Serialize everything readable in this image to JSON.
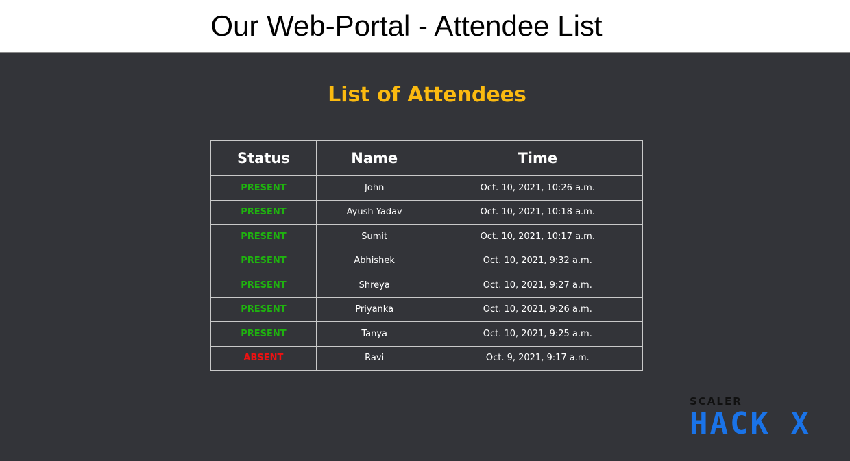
{
  "slide": {
    "title": "Our Web-Portal - Attendee List"
  },
  "page": {
    "heading": "List of Attendees"
  },
  "table": {
    "headers": {
      "status": "Status",
      "name": "Name",
      "time": "Time"
    },
    "rows": [
      {
        "status": "PRESENT",
        "name": "John",
        "time": "Oct. 10, 2021, 10:26 a.m."
      },
      {
        "status": "PRESENT",
        "name": "Ayush Yadav",
        "time": "Oct. 10, 2021, 10:18 a.m."
      },
      {
        "status": "PRESENT",
        "name": "Sumit",
        "time": "Oct. 10, 2021, 10:17 a.m."
      },
      {
        "status": "PRESENT",
        "name": "Abhishek",
        "time": "Oct. 10, 2021, 9:32 a.m."
      },
      {
        "status": "PRESENT",
        "name": "Shreya",
        "time": "Oct. 10, 2021, 9:27 a.m."
      },
      {
        "status": "PRESENT",
        "name": "Priyanka",
        "time": "Oct. 10, 2021, 9:26 a.m."
      },
      {
        "status": "PRESENT",
        "name": "Tanya",
        "time": "Oct. 10, 2021, 9:25 a.m."
      },
      {
        "status": "ABSENT",
        "name": "Ravi",
        "time": "Oct. 9, 2021, 9:17 a.m."
      }
    ]
  },
  "colors": {
    "present": "#1fb20f",
    "absent": "#ee1111",
    "heading": "#fbba10",
    "background": "#333439"
  },
  "logo": {
    "small": "SCALER",
    "big": "HACK X"
  }
}
